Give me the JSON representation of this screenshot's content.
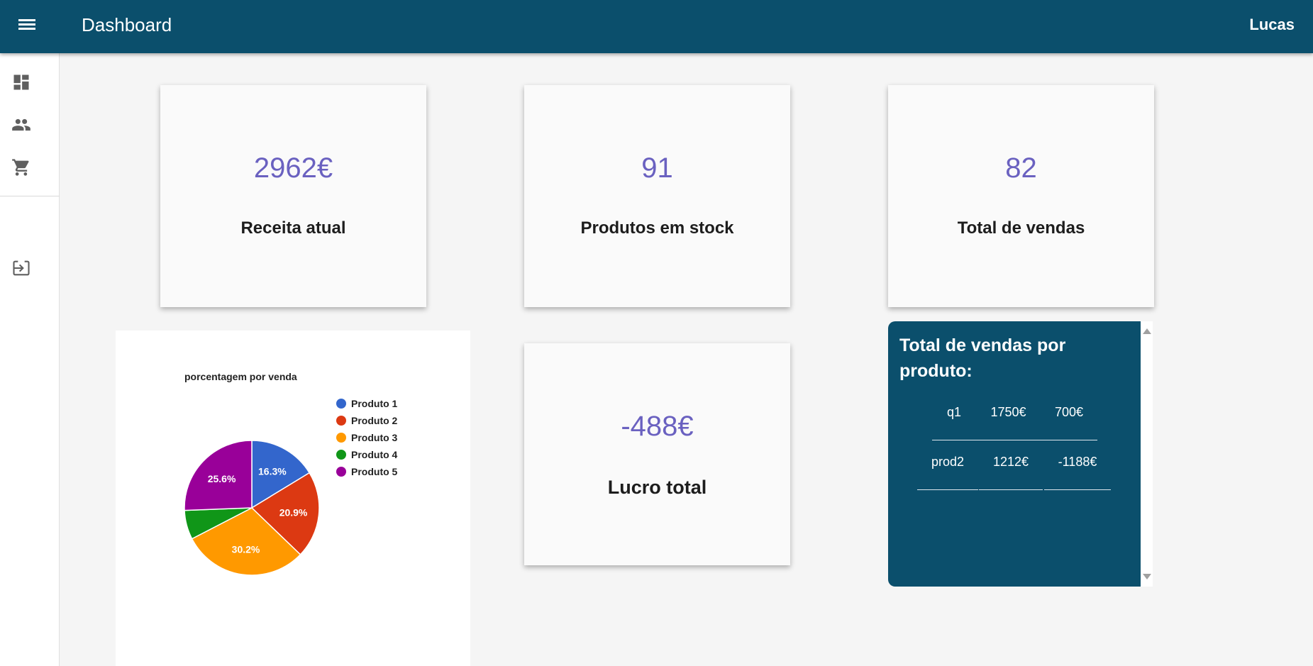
{
  "header": {
    "title": "Dashboard",
    "user": "Lucas"
  },
  "sidebar": {
    "icons": [
      "dashboard-icon",
      "people-icon",
      "cart-icon",
      "logout-icon"
    ]
  },
  "cards": [
    {
      "value": "2962€",
      "label": "Receita atual"
    },
    {
      "value": "91",
      "label": "Produtos em stock"
    },
    {
      "value": "82",
      "label": "Total de vendas"
    },
    {
      "value": "-488€",
      "label": "Lucro total"
    }
  ],
  "sales_panel": {
    "title": "Total de vendas por produto:",
    "rows": [
      [
        "q1",
        "1750€",
        "700€"
      ],
      [
        "prod2",
        "1212€",
        "-1188€"
      ]
    ]
  },
  "chart_data": {
    "type": "pie",
    "title": "porcentagem por venda",
    "categories": [
      "Produto 1",
      "Produto 2",
      "Produto 3",
      "Produto 4",
      "Produto 5"
    ],
    "values": [
      16.3,
      20.9,
      30.2,
      7.0,
      25.6
    ],
    "labels": [
      "16.3%",
      "20.9%",
      "30.2%",
      "",
      "25.6%"
    ],
    "colors": [
      "#3366cc",
      "#dc3912",
      "#ff9900",
      "#109618",
      "#990099"
    ],
    "legend": "right"
  }
}
